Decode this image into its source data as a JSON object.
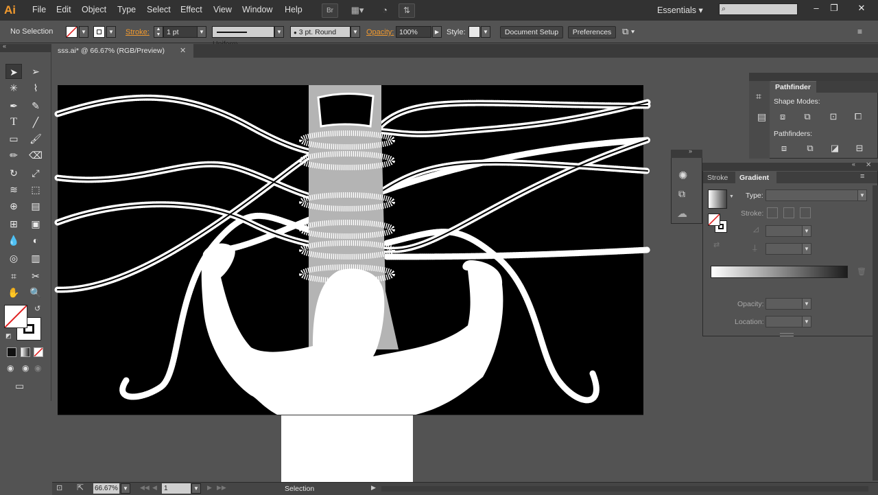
{
  "app": {
    "logo": "Ai"
  },
  "menubar": {
    "items": [
      "File",
      "Edit",
      "Object",
      "Type",
      "Select",
      "Effect",
      "View",
      "Window",
      "Help"
    ],
    "bridge_label": "Br",
    "workspace": "Essentials",
    "search_placeholder": "",
    "window_buttons": {
      "minimize": "–",
      "restore": "❐",
      "close": "✕"
    }
  },
  "control_bar": {
    "selection": "No Selection",
    "stroke_label": "Stroke:",
    "stroke_weight": "1 pt",
    "profile": "Uniform",
    "brush": "3 pt. Round",
    "opacity_label": "Opacity:",
    "opacity": "100%",
    "style_label": "Style:",
    "document_setup": "Document Setup",
    "preferences": "Preferences"
  },
  "document": {
    "tab_title": "sss.ai* @ 66.67% (RGB/Preview)",
    "close": "✕"
  },
  "statusbar": {
    "zoom": "66.67%",
    "page": "1",
    "tool": "Selection"
  },
  "panels": {
    "pathfinder": {
      "title": "Pathfinder",
      "shape_modes_label": "Shape Modes:",
      "pathfinders_label": "Pathfinders:"
    },
    "gradient": {
      "tab_stroke": "Stroke",
      "tab_gradient": "Gradient",
      "type_label": "Type:",
      "stroke_label": "Stroke:",
      "opacity_label": "Opacity:",
      "location_label": "Location:"
    }
  },
  "colors": {
    "accent": "#f29a2e",
    "canvas": "#535353",
    "artboard": "#000000",
    "pillar": "#b4b4b4",
    "figure": "#ffffff"
  }
}
